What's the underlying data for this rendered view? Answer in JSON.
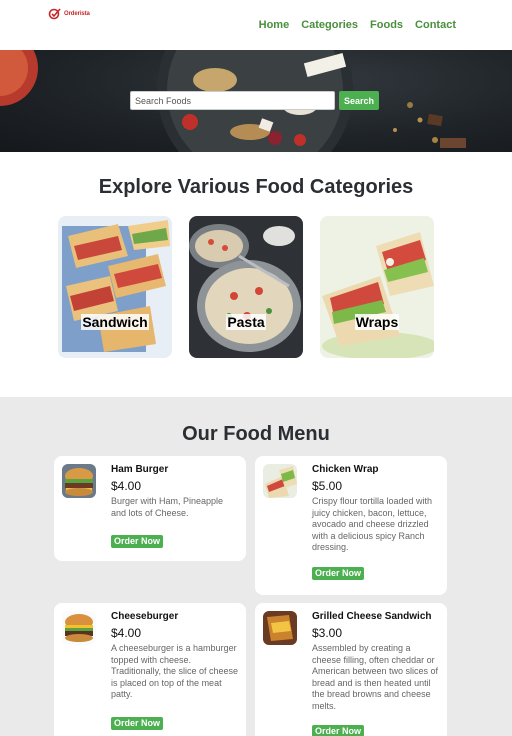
{
  "brand": {
    "name": "Orderista",
    "color": "#c62828"
  },
  "nav": {
    "items": [
      "Home",
      "Categories",
      "Foods",
      "Contact"
    ],
    "color": "#4a8f3c"
  },
  "hero": {
    "search_placeholder": "Search Foods",
    "search_button": "Search"
  },
  "categories": {
    "title": "Explore Various Food Categories",
    "items": [
      {
        "label": "Sandwich",
        "icon": "sandwich-image"
      },
      {
        "label": "Pasta",
        "icon": "pasta-image"
      },
      {
        "label": "Wraps",
        "icon": "wrap-image"
      }
    ]
  },
  "menu": {
    "title": "Our Food Menu",
    "items": [
      {
        "name": "Ham Burger",
        "price": "$4.00",
        "desc": "Burger with Ham, Pineapple and lots of Cheese.",
        "button": "Order Now"
      },
      {
        "name": "Chicken Wrap",
        "price": "$5.00",
        "desc": "Crispy flour tortilla loaded with juicy chicken, bacon, lettuce, avocado and cheese drizzled with a delicious spicy Ranch dressing.",
        "button": "Order Now"
      },
      {
        "name": "Cheeseburger",
        "price": "$4.00",
        "desc": "A cheeseburger is a hamburger topped with cheese. Traditionally, the slice of cheese is placed on top of the meat patty.",
        "button": "Order Now"
      },
      {
        "name": "Grilled Cheese Sandwich",
        "price": "$3.00",
        "desc": "Assembled by creating a cheese filling, often cheddar or American between two slices of bread and is then heated until the bread browns and cheese melts.",
        "button": "Order Now"
      }
    ]
  },
  "colors": {
    "accent": "#4caf50",
    "menu_bg": "#eaeaea",
    "heading": "#2b2f33"
  }
}
